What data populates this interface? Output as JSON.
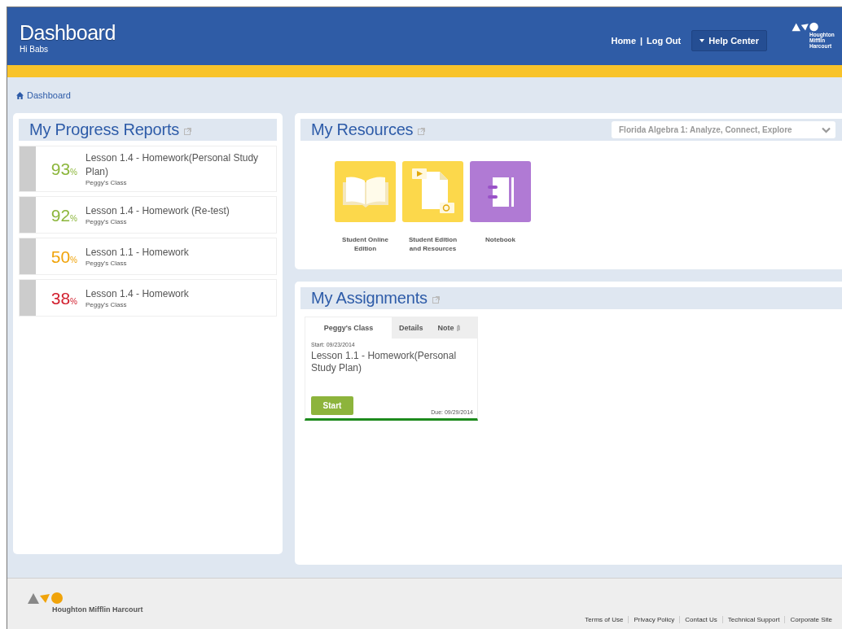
{
  "header": {
    "title": "Dashboard",
    "greeting": "Hi Babs",
    "links": [
      "Home",
      "Log Out"
    ],
    "separator": "|",
    "help_button": "Help Center",
    "logo_text": "Houghton Mifflin Harcourt"
  },
  "breadcrumb": "Dashboard",
  "progress_reports": {
    "title": "My Progress Reports",
    "items": [
      {
        "score": "93",
        "unit": "%",
        "color": "#8cb63c",
        "title": "Lesson 1.4 - Homework(Personal Study Plan)",
        "class": "Peggy's Class"
      },
      {
        "score": "92",
        "unit": "%",
        "color": "#8cb63c",
        "title": "Lesson 1.4 - Homework (Re-test)",
        "class": "Peggy's Class"
      },
      {
        "score": "50",
        "unit": "%",
        "color": "#f0a30a",
        "title": "Lesson 1.1 - Homework",
        "class": "Peggy's Class"
      },
      {
        "score": "38",
        "unit": "%",
        "color": "#d2202f",
        "title": "Lesson 1.4 - Homework",
        "class": "Peggy's Class"
      }
    ]
  },
  "resources": {
    "title": "My Resources",
    "program_select": "Florida Algebra 1: Analyze, Connect, Explore",
    "items": [
      {
        "kind": "book",
        "label": "Student Online Edition"
      },
      {
        "kind": "media",
        "label": "Student Edition and Resources"
      },
      {
        "kind": "notebook",
        "label": "Notebook"
      }
    ]
  },
  "assignments": {
    "title": "My Assignments",
    "cards": [
      {
        "tabs": [
          {
            "label": "Peggy's Class",
            "selected": true
          },
          {
            "label": "Details",
            "selected": false
          },
          {
            "label": "Note",
            "selected": false
          }
        ],
        "start": "Start: 09/23/2014",
        "title": "Lesson 1.1 - Homework(Personal Study Plan)",
        "button": "Start",
        "due": "Due: 09/29/2014"
      }
    ]
  },
  "footer": {
    "logo_text": "Houghton Mifflin Harcourt",
    "links": [
      "Terms of Use",
      "Privacy Policy",
      "Contact Us",
      "Technical Support",
      "Corporate Site"
    ]
  }
}
